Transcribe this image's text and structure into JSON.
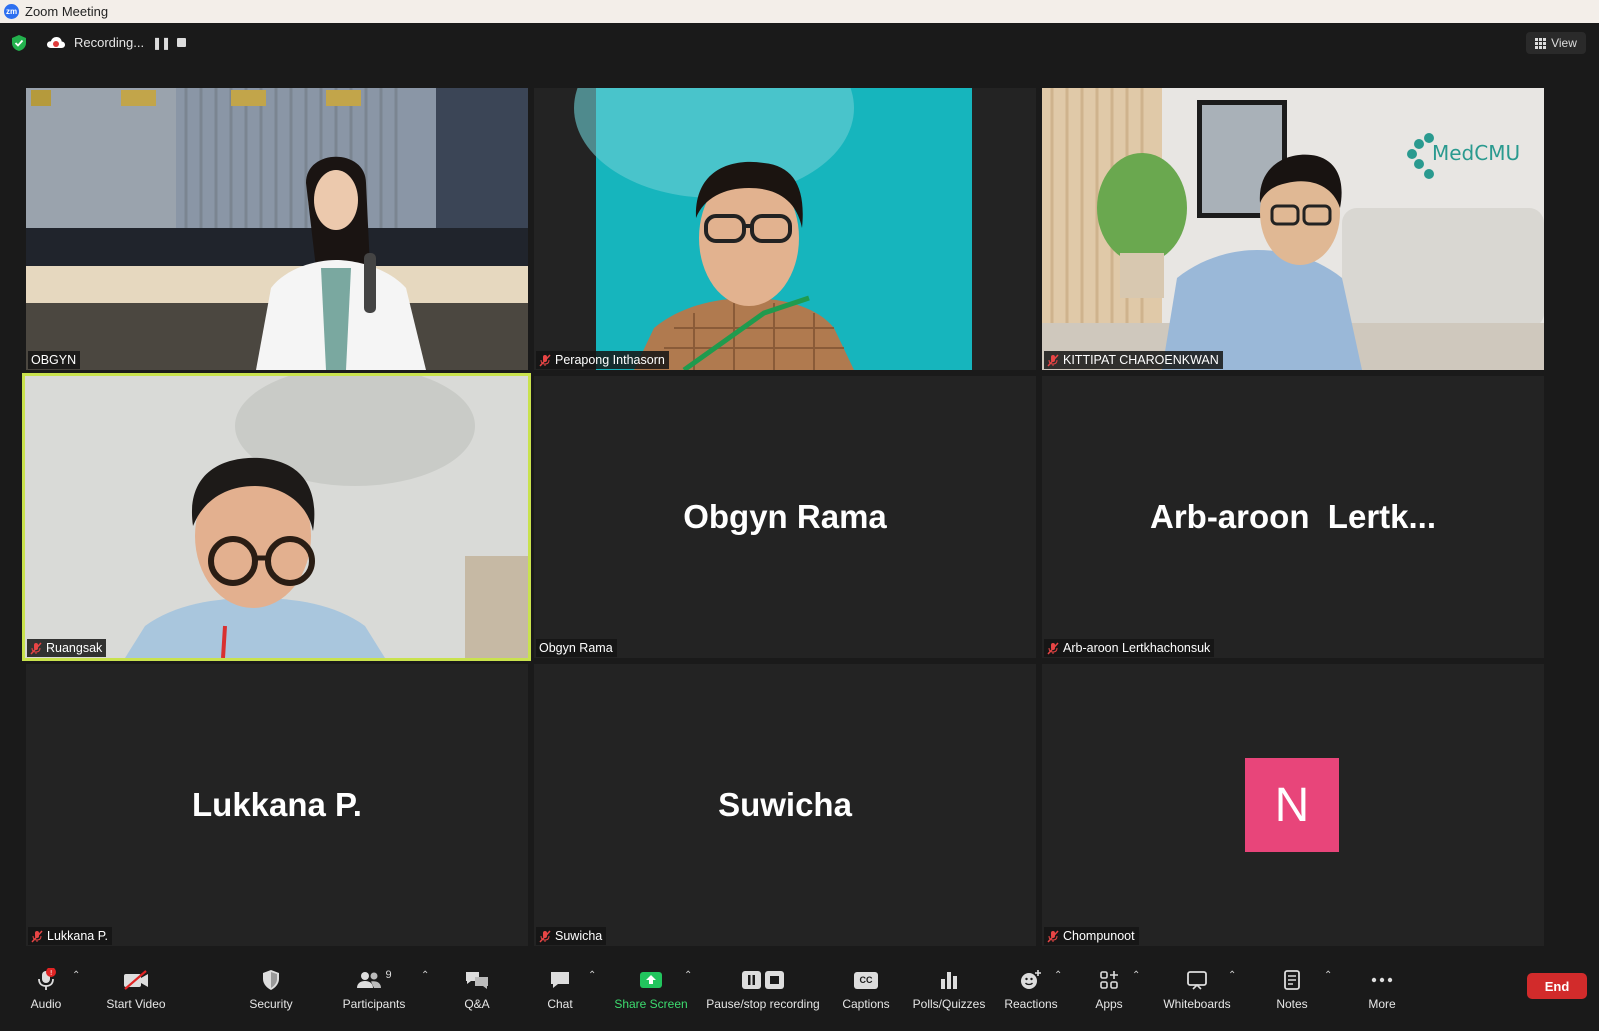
{
  "window": {
    "title": "Zoom Meeting",
    "logo_text": "zm"
  },
  "recording": {
    "status": "Recording..."
  },
  "view": {
    "label": "View"
  },
  "tiles": [
    {
      "label": "OBGYN",
      "big": ""
    },
    {
      "label": "Perapong Inthasorn",
      "big": ""
    },
    {
      "label": "KITTIPAT CHAROENKWAN",
      "big": ""
    },
    {
      "label": "Ruangsak",
      "big": ""
    },
    {
      "label": "Obgyn Rama",
      "big": "Obgyn Rama"
    },
    {
      "label": "Arb-aroon Lertkhachonsuk",
      "big": "Arb-aroon  Lertk..."
    },
    {
      "label": "Lukkana P.",
      "big": "Lukkana P."
    },
    {
      "label": "Suwicha",
      "big": "Suwicha"
    },
    {
      "label": "Chompunoot",
      "big": "",
      "avatar_letter": "N",
      "avatar_color": "#e8457a"
    }
  ],
  "medcmu_logo_text": "MedCMU",
  "toolbar": {
    "audio": "Audio",
    "start_video": "Start Video",
    "security": "Security",
    "participants": "Participants",
    "participants_count": "9",
    "qa": "Q&A",
    "chat": "Chat",
    "share_screen": "Share Screen",
    "pause_stop": "Pause/stop recording",
    "captions": "Captions",
    "captions_icon": "CC",
    "polls": "Polls/Quizzes",
    "reactions": "Reactions",
    "apps": "Apps",
    "whiteboards": "Whiteboards",
    "notes": "Notes",
    "more": "More",
    "end": "End"
  },
  "colors": {
    "active_speaker": "#c9e24d",
    "share_green": "#22c55e",
    "end_red": "#d22b2b",
    "avatar_pink": "#e8457a"
  }
}
